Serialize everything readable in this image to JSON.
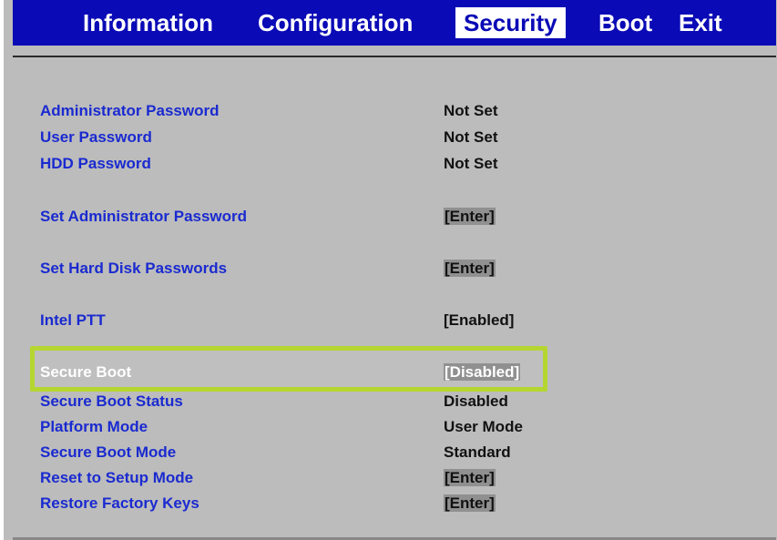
{
  "menu": {
    "tabs": [
      {
        "label": "Information"
      },
      {
        "label": "Configuration"
      },
      {
        "label": "Security"
      },
      {
        "label": "Boot"
      },
      {
        "label": "Exit"
      }
    ],
    "active_tab": "Security"
  },
  "settings": [
    {
      "label": "Administrator Password",
      "value": "Not Set"
    },
    {
      "label": "User Password",
      "value": "Not Set"
    },
    {
      "label": "HDD Password",
      "value": "Not Set"
    },
    {
      "label": "Set Administrator Password",
      "value": "[Enter]"
    },
    {
      "label": "Set Hard Disk Passwords",
      "value": "[Enter]"
    },
    {
      "label": "Intel PTT",
      "value": "[Enabled]"
    },
    {
      "label": "Secure Boot",
      "value": "[Disabled]"
    },
    {
      "label": "Secure Boot Status",
      "value": "Disabled"
    },
    {
      "label": "Platform Mode",
      "value": "User Mode"
    },
    {
      "label": "Secure Boot Mode",
      "value": "Standard"
    },
    {
      "label": "Reset to Setup Mode",
      "value": "[Enter]"
    },
    {
      "label": "Restore Factory Keys",
      "value": "[Enter]"
    }
  ],
  "selected_item": "Secure Boot",
  "colors": {
    "menu_background": "#0a0ab6",
    "screen_background": "#bcbcbc",
    "label_text": "#1a2ad0",
    "value_text": "#111111",
    "highlight_outline": "#b5d630"
  }
}
